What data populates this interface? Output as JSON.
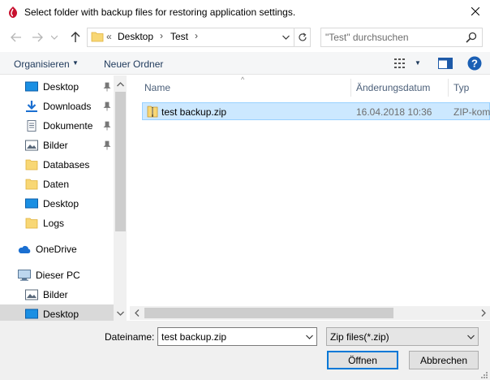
{
  "window": {
    "title": "Select folder with backup files for restoring application settings."
  },
  "address": {
    "chevrons": "«",
    "segments": [
      "Desktop",
      "Test"
    ]
  },
  "search": {
    "placeholder": "\"Test\" durchsuchen"
  },
  "toolbar": {
    "organize_label": "Organisieren",
    "new_folder_label": "Neuer Ordner"
  },
  "nav": {
    "items": [
      {
        "label": "Desktop",
        "icon": "desktop-icon",
        "pinned": true
      },
      {
        "label": "Downloads",
        "icon": "download-icon",
        "pinned": true
      },
      {
        "label": "Dokumente",
        "icon": "document-icon",
        "pinned": true
      },
      {
        "label": "Bilder",
        "icon": "pictures-icon",
        "pinned": true
      },
      {
        "label": "Databases",
        "icon": "folder-icon",
        "pinned": false
      },
      {
        "label": "Daten",
        "icon": "folder-icon",
        "pinned": false
      },
      {
        "label": "Desktop",
        "icon": "desktop-icon",
        "pinned": false
      },
      {
        "label": "Logs",
        "icon": "folder-icon",
        "pinned": false
      },
      {
        "label": "OneDrive",
        "icon": "cloud-icon",
        "pinned": false
      },
      {
        "label": "Dieser PC",
        "icon": "computer-icon",
        "pinned": false
      },
      {
        "label": "Bilder",
        "icon": "pictures-icon",
        "pinned": false
      },
      {
        "label": "Desktop",
        "icon": "desktop-icon",
        "pinned": false,
        "selected": true
      }
    ]
  },
  "columns": {
    "name": "Name",
    "date": "Änderungsdatum",
    "type": "Typ"
  },
  "files": [
    {
      "name": "test backup.zip",
      "date": "16.04.2018 10:36",
      "type": "ZIP-komprimierter Ordner",
      "icon": "zip-folder-icon",
      "selected": true
    }
  ],
  "footer": {
    "filename_label": "Dateiname:",
    "filename_value": "test backup.zip",
    "filter_value": "Zip files(*.zip)",
    "open_label": "Öffnen",
    "cancel_label": "Abbrechen"
  },
  "colors": {
    "selection": "#cce8ff",
    "selection_border": "#99d1ff",
    "accent": "#0078d7",
    "toolbar_text": "#1e395b"
  }
}
